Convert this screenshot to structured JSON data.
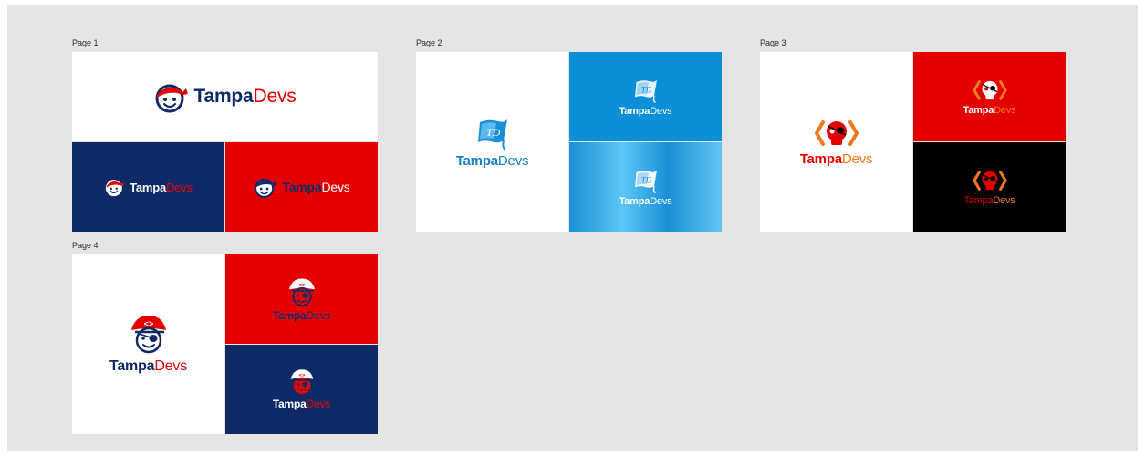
{
  "colors": {
    "navy": "#0e2a66",
    "red": "#e40000",
    "blue": "#1290d8",
    "black": "#000000",
    "orange": "#f07a1a",
    "canvas": "#e5e5e5"
  },
  "pages": [
    {
      "label": "Page 1",
      "word1": "Tampa",
      "word2": "Devs"
    },
    {
      "label": "Page 2",
      "word1": "Tampa",
      "word2": "Devs"
    },
    {
      "label": "Page 3",
      "word1": "Tampa",
      "word2": "Devs"
    },
    {
      "label": "Page 4",
      "word1": "Tampa",
      "word2": "Devs"
    }
  ],
  "icons": {
    "page1": "bandana-kid-mascot-icon",
    "page2": "flag-td-icon",
    "page3": "pirate-skull-brackets-icon",
    "page4": "pirate-kid-mascot-icon"
  }
}
